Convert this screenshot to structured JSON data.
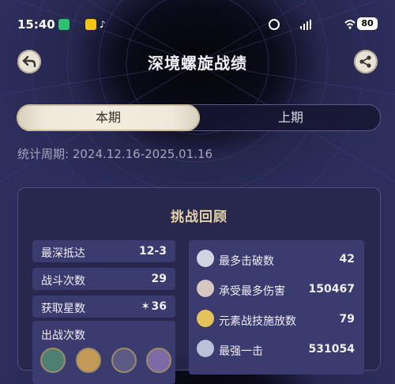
{
  "status_bar": {
    "time": "15:40",
    "battery": "80",
    "icons": [
      "app-green-icon",
      "app-yellow-icon",
      "tiktok-icon",
      "alarm-icon",
      "signal-icon",
      "wifi-icon"
    ]
  },
  "header": {
    "title": "深境螺旋战绩",
    "back_icon": "back-arrow-icon",
    "share_icon": "share-icon"
  },
  "tabs": [
    {
      "label": "本期",
      "active": true
    },
    {
      "label": "上期",
      "active": false
    }
  ],
  "period": "统计周期: 2024.12.16-2025.01.16",
  "panel": {
    "title": "挑战回顾",
    "stats": [
      {
        "label": "最深抵达",
        "value": "12-3"
      },
      {
        "label": "战斗次数",
        "value": "29"
      },
      {
        "label": "获取星数",
        "value": "36"
      }
    ],
    "uses_label": "出战次数",
    "records": [
      {
        "label": "最多击破数",
        "value": "42"
      },
      {
        "label": "承受最多伤害",
        "value": "150467"
      },
      {
        "label": "元素战技施放数",
        "value": "79"
      },
      {
        "label": "最强一击",
        "value": "531054"
      }
    ]
  },
  "colors": {
    "accent_gold": "#e3d2a4",
    "tab_active_bg": "#efe9db",
    "row_bg": "#3a3b6e",
    "panel_bg": "#28284e"
  }
}
